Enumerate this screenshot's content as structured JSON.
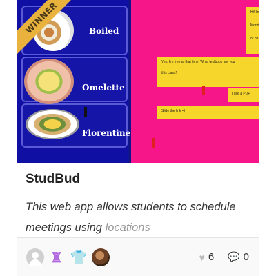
{
  "thumbnail": {
    "badge": "WINNER",
    "menu_items": [
      "Boiled",
      "Omelette",
      "Florentine"
    ],
    "chat": {
      "top_right_lines": [
        "Hi! I'm look",
        "Monday at",
        "or on zoom"
      ],
      "message_1_lines": [
        "Yes, I'm free at that time! What textbook are you",
        "this class?"
      ],
      "message_2": "I use a PDF",
      "message_3": "Slide the link =)"
    }
  },
  "project": {
    "title": "StudBud",
    "description_visible": "This web app allows students to schedule meetings using ",
    "description_faded": "locations"
  },
  "footer": {
    "likes": "6",
    "comments": "0"
  }
}
